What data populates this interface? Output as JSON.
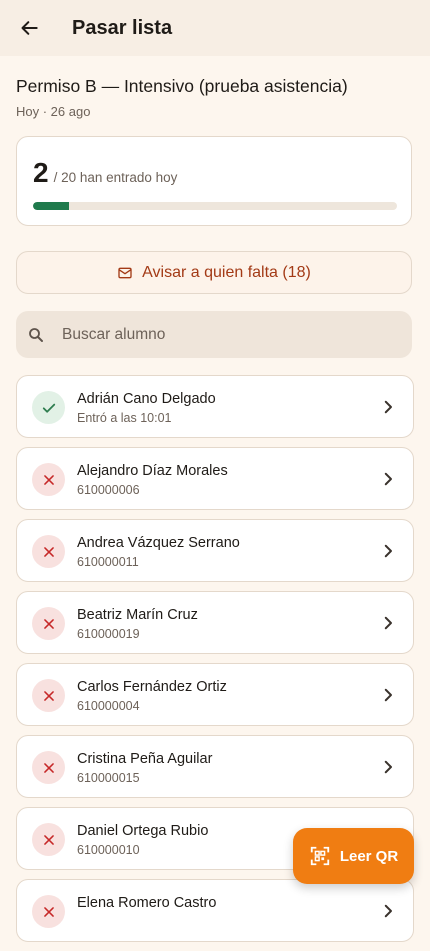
{
  "appbar": {
    "title": "Pasar lista",
    "back_icon": "arrow-left-icon"
  },
  "course": {
    "title": "Permiso B — Intensivo (prueba asistencia)",
    "subtitle": "Hoy · 26 ago"
  },
  "stats": {
    "present": "2",
    "label": "/ 20 han entrado hoy",
    "progress_fraction": 0.1,
    "progress_color": "#1F7A4C"
  },
  "notify_button": {
    "label": "Avisar a quien falta (18)",
    "icon": "mail-icon"
  },
  "search": {
    "placeholder": "Buscar alumno",
    "value": "",
    "icon": "search-icon"
  },
  "students": [
    {
      "name": "Adrián Cano Delgado",
      "detail": "Entró a las 10:01",
      "status": "present"
    },
    {
      "name": "Alejandro Díaz Morales",
      "detail": "610000006",
      "status": "absent"
    },
    {
      "name": "Andrea Vázquez Serrano",
      "detail": "610000011",
      "status": "absent"
    },
    {
      "name": "Beatriz Marín Cruz",
      "detail": "610000019",
      "status": "absent"
    },
    {
      "name": "Carlos Fernández Ortiz",
      "detail": "610000004",
      "status": "absent"
    },
    {
      "name": "Cristina Peña Aguilar",
      "detail": "610000015",
      "status": "absent"
    },
    {
      "name": "Daniel Ortega Rubio",
      "detail": "610000010",
      "status": "absent"
    },
    {
      "name": "Elena Romero Castro",
      "detail": "",
      "status": "absent"
    }
  ],
  "fab": {
    "label": "Leer QR",
    "icon": "qr-scan-icon"
  },
  "colors": {
    "accent": "#F07D12",
    "present": "#2E7D4F",
    "absent": "#C62828",
    "background": "#FDF6EE"
  }
}
